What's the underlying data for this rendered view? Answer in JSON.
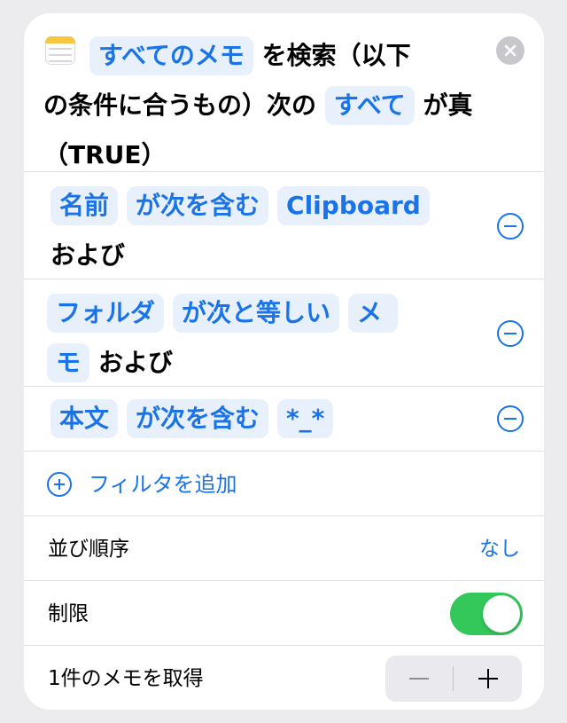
{
  "header": {
    "chip_all_notes": "すべてのメモ",
    "text_search": "を検索（以下",
    "text_condition": "の条件に合うもの）次の",
    "chip_all": "すべて",
    "text_is_true": "が真",
    "text_true": "（TRUE）"
  },
  "filters": [
    {
      "field": "名前",
      "operator": "が次を含む",
      "value": "Clipboard",
      "conjunction": "および"
    },
    {
      "field": "フォルダ",
      "operator": "が次と等しい",
      "value_part1": "メ",
      "value_part2": "モ",
      "conjunction": "および"
    },
    {
      "field": "本文",
      "operator": "が次を含む",
      "value": "*_*"
    }
  ],
  "add_filter_label": "フィルタを追加",
  "sort": {
    "label": "並び順序",
    "value": "なし"
  },
  "limit": {
    "label": "制限",
    "enabled": true,
    "color": "#34c759"
  },
  "count": {
    "label": "1件のメモを取得",
    "minus": "−",
    "plus": "+"
  },
  "colors": {
    "accent": "#1a73e8",
    "chip_bg": "#e8f1fb"
  }
}
